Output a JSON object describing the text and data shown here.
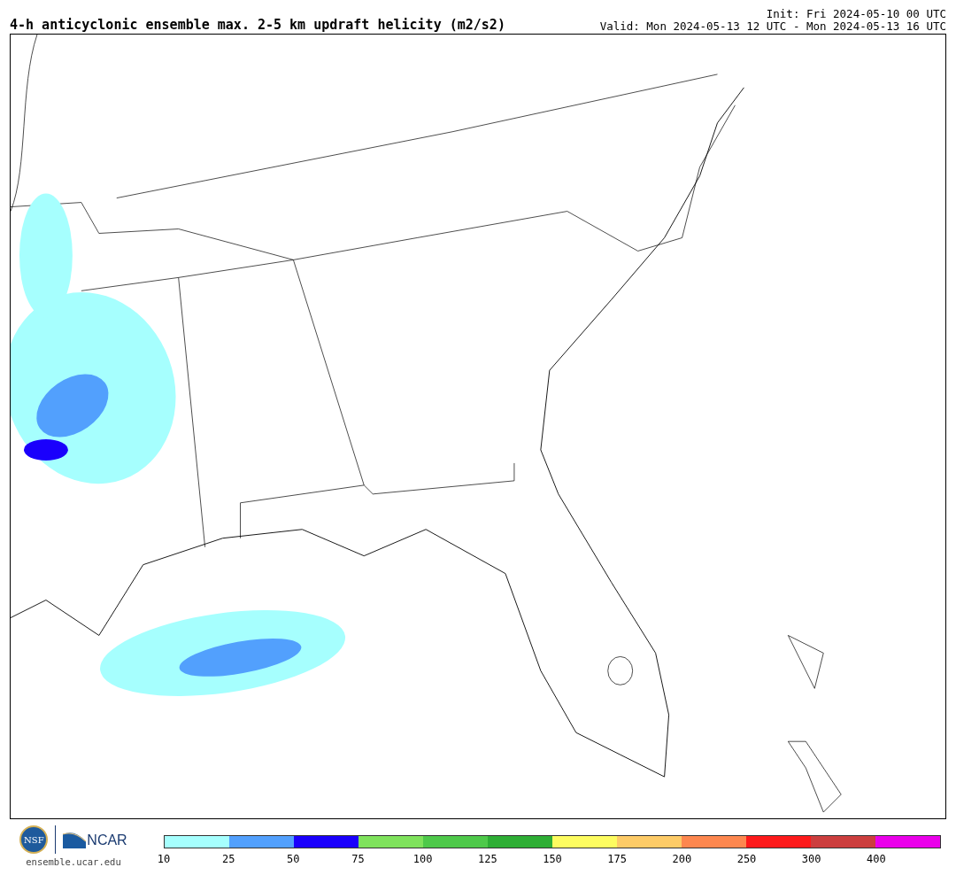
{
  "title": "4-h anticyclonic ensemble max. 2-5 km updraft helicity (m2/s2)",
  "init": "Init: Fri 2024-05-10 00 UTC",
  "valid": "Valid: Mon 2024-05-13 12 UTC - Mon 2024-05-13 16 UTC",
  "logos": {
    "nsf": "NSF",
    "ncar": "NCAR",
    "site": "ensemble.ucar.edu"
  },
  "colorbar": [
    {
      "color": "#a6fffe",
      "label": "10"
    },
    {
      "color": "#52a0fd",
      "label": "25"
    },
    {
      "color": "#1a00fc",
      "label": "50"
    },
    {
      "color": "#7fe25c",
      "label": "75"
    },
    {
      "color": "#4ec94a",
      "label": "100"
    },
    {
      "color": "#2eae35",
      "label": "125"
    },
    {
      "color": "#fdfc60",
      "label": "150"
    },
    {
      "color": "#fdcb67",
      "label": "175"
    },
    {
      "color": "#fd874f",
      "label": "200"
    },
    {
      "color": "#fd1a1b",
      "label": "250"
    },
    {
      "color": "#cc3e3e",
      "label": "300"
    },
    {
      "color": "#ea00ea",
      "label": "400"
    }
  ]
}
